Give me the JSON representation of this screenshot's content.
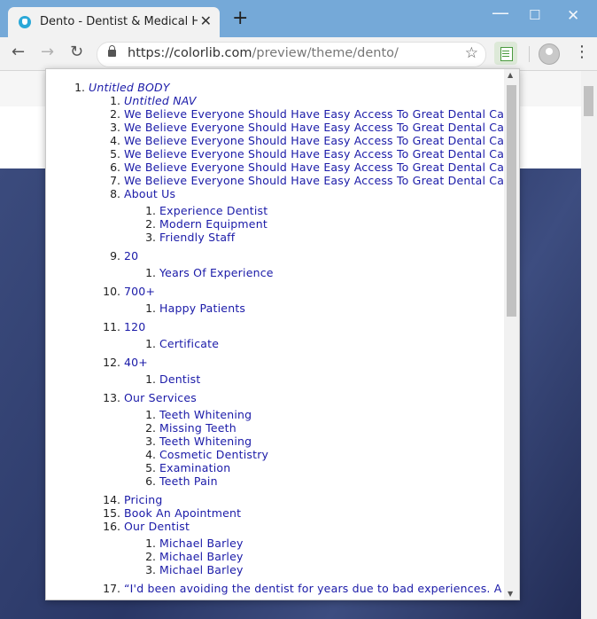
{
  "browser": {
    "tab_title": "Dento - Dentist & Medical HTM",
    "tab_close": "✕",
    "new_tab": "+",
    "window_controls": {
      "minimize": "—",
      "maximize": "☐",
      "close": "✕"
    },
    "nav": {
      "back": "←",
      "forward": "→",
      "reload": "↻"
    },
    "url_host": "https://colorlib.com",
    "url_path": "/preview/theme/dento/",
    "star": "☆",
    "menu": "⋮"
  },
  "outline": {
    "items": [
      {
        "label": "Untitled BODY",
        "italic": true,
        "children": [
          {
            "label": "Untitled NAV",
            "italic": true,
            "children": []
          },
          {
            "label": "We Believe Everyone Should Have Easy Access To Great Dental Care",
            "children": []
          },
          {
            "label": "We Believe Everyone Should Have Easy Access To Great Dental Care",
            "children": []
          },
          {
            "label": "We Believe Everyone Should Have Easy Access To Great Dental Care",
            "children": []
          },
          {
            "label": "We Believe Everyone Should Have Easy Access To Great Dental Care",
            "children": []
          },
          {
            "label": "We Believe Everyone Should Have Easy Access To Great Dental Care",
            "children": []
          },
          {
            "label": "We Believe Everyone Should Have Easy Access To Great Dental Care",
            "children": []
          },
          {
            "label": "About Us",
            "children": [
              "Experience Dentist",
              "Modern Equipment",
              "Friendly Staff"
            ]
          },
          {
            "label": "20",
            "children": [
              "Years Of Experience"
            ]
          },
          {
            "label": "700+",
            "children": [
              "Happy Patients"
            ]
          },
          {
            "label": "120",
            "children": [
              "Certificate"
            ]
          },
          {
            "label": "40+",
            "children": [
              "Dentist"
            ]
          },
          {
            "label": "Our Services",
            "children": [
              "Teeth Whitening",
              "Missing Teeth",
              "Teeth Whitening",
              "Cosmetic Dentistry",
              "Examination",
              "Teeth Pain"
            ]
          },
          {
            "label": "Pricing",
            "children": []
          },
          {
            "label": "Book An Apointment",
            "children": []
          },
          {
            "label": "Our Dentist",
            "children": [
              "Michael Barley",
              "Michael Barley",
              "Michael Barley"
            ]
          },
          {
            "label": "“I'd been avoiding the dentist for years due to bad experiences. A",
            "children": []
          }
        ]
      }
    ]
  }
}
